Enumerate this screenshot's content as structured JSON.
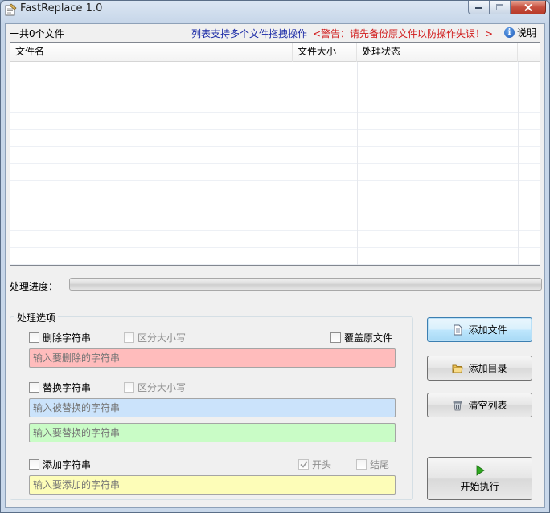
{
  "window": {
    "title": "FastReplace 1.0"
  },
  "header": {
    "file_count": "一共0个文件",
    "hint": "列表支持多个文件拖拽操作",
    "warning": "<警告：请先备份原文件以防操作失误！>",
    "help": "说明"
  },
  "file_list": {
    "columns": [
      "文件名",
      "文件大小",
      "处理状态"
    ],
    "rows": []
  },
  "progress": {
    "label": "处理进度：",
    "value": 0
  },
  "options": {
    "title": "处理选项",
    "delete": {
      "label": "删除字符串",
      "checked": false,
      "case_label": "区分大小写",
      "case_checked": false,
      "placeholder": "输入要删除的字符串"
    },
    "overwrite": {
      "label": "覆盖原文件",
      "checked": false
    },
    "replace": {
      "label": "替换字符串",
      "checked": false,
      "case_label": "区分大小写",
      "case_checked": false,
      "find_placeholder": "输入被替换的字符串",
      "with_placeholder": "输入要替换的字符串"
    },
    "add": {
      "label": "添加字符串",
      "checked": false,
      "start_label": "开头",
      "start_checked": true,
      "end_label": "结尾",
      "end_checked": false,
      "placeholder": "输入要添加的字符串"
    }
  },
  "buttons": {
    "add_file": "添加文件",
    "add_dir": "添加目录",
    "clear_list": "清空列表",
    "start": "开始执行"
  },
  "colors": {
    "delete_field": "#ffbcbc",
    "find_field": "#cbe3fb",
    "replace_field": "#c9fcc6",
    "add_field": "#fdfdb8",
    "hint": "#1a2aa6",
    "warning": "#d11c1c",
    "play": "#2ea81f"
  }
}
